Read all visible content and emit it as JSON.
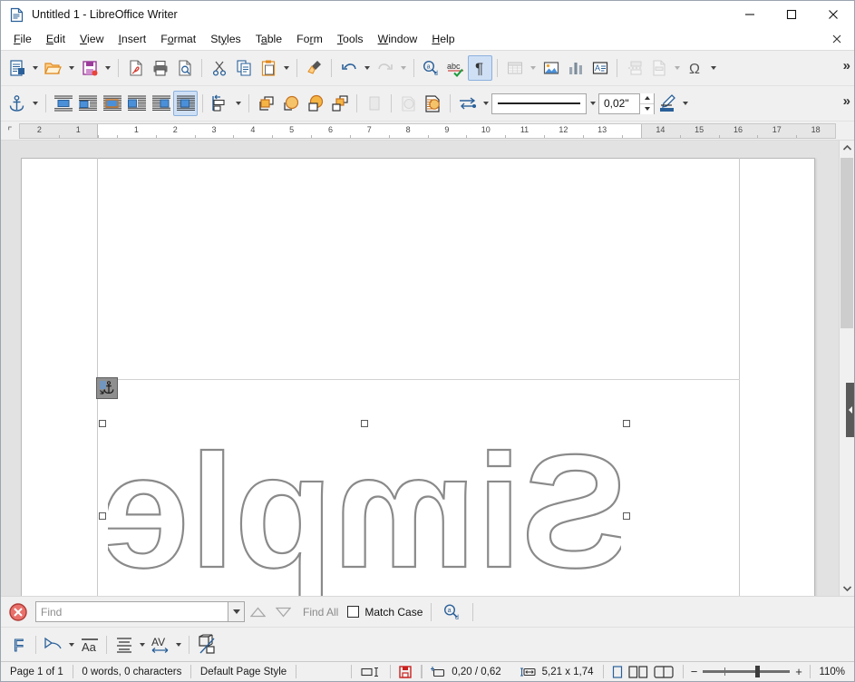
{
  "window": {
    "title": "Untitled 1 - LibreOffice Writer",
    "icon": "writer-document-icon",
    "minimize_label": "—",
    "maximize_label": "□",
    "close_label": "✕",
    "document_close_label": "✕"
  },
  "menubar": {
    "items": [
      {
        "label": "File",
        "accel": "F"
      },
      {
        "label": "Edit",
        "accel": "E"
      },
      {
        "label": "View",
        "accel": "V"
      },
      {
        "label": "Insert",
        "accel": "I"
      },
      {
        "label": "Format",
        "accel": "o"
      },
      {
        "label": "Styles",
        "accel": "y"
      },
      {
        "label": "Table",
        "accel": "a"
      },
      {
        "label": "Form",
        "accel": "r"
      },
      {
        "label": "Tools",
        "accel": "T"
      },
      {
        "label": "Window",
        "accel": "W"
      },
      {
        "label": "Help",
        "accel": "H"
      }
    ]
  },
  "standard_toolbar": {
    "items": [
      {
        "name": "new-document-button",
        "label": "New",
        "dropdown": true
      },
      {
        "name": "open-button",
        "label": "Open",
        "dropdown": true
      },
      {
        "name": "save-button",
        "label": "Save",
        "dropdown": true
      },
      {
        "name": "export-pdf-button",
        "label": "Export as PDF"
      },
      {
        "name": "print-button",
        "label": "Print"
      },
      {
        "name": "print-preview-button",
        "label": "Toggle Print Preview"
      },
      {
        "name": "cut-button",
        "label": "Cut"
      },
      {
        "name": "copy-button",
        "label": "Copy"
      },
      {
        "name": "paste-button",
        "label": "Paste",
        "dropdown": true
      },
      {
        "name": "clone-formatting-button",
        "label": "Clone Formatting"
      },
      {
        "name": "undo-button",
        "label": "Undo",
        "dropdown": true
      },
      {
        "name": "redo-button",
        "label": "Redo",
        "dropdown": true,
        "disabled": true
      },
      {
        "name": "find-and-replace-button",
        "label": "Find and Replace"
      },
      {
        "name": "spelling-button",
        "label": "Check Spelling"
      },
      {
        "name": "formatting-marks-button",
        "label": "Formatting Marks",
        "active": true
      },
      {
        "name": "insert-table-button",
        "label": "Insert Table",
        "dropdown": true,
        "disabled": true
      },
      {
        "name": "insert-image-button",
        "label": "Insert Image"
      },
      {
        "name": "insert-chart-button",
        "label": "Insert Chart"
      },
      {
        "name": "insert-text-box-button",
        "label": "Insert Text Box"
      },
      {
        "name": "insert-page-break-button",
        "label": "Insert Page Break",
        "disabled": true
      },
      {
        "name": "insert-field-button",
        "label": "Insert Field",
        "dropdown": true,
        "disabled": true
      },
      {
        "name": "insert-special-character-button",
        "label": "Insert Special Character",
        "dropdown": true
      }
    ],
    "overflow_label": "»"
  },
  "image_toolbar": {
    "items": [
      {
        "name": "anchor-button",
        "label": "Anchor",
        "dropdown": true
      },
      {
        "name": "wrap-off-button",
        "label": "Wrap Off"
      },
      {
        "name": "wrap-page-button",
        "label": "Wrap Page"
      },
      {
        "name": "wrap-through-button",
        "label": "Wrap Through"
      },
      {
        "name": "wrap-left-button",
        "label": "Wrap Left"
      },
      {
        "name": "wrap-right-button",
        "label": "Wrap Right"
      },
      {
        "name": "wrap-optimal-button",
        "label": "Optimal Page Wrap",
        "active": true
      },
      {
        "name": "align-objects-button",
        "label": "Align Objects",
        "dropdown": true
      },
      {
        "name": "bring-forward-button",
        "label": "Bring Forward"
      },
      {
        "name": "bring-to-front-button",
        "label": "Bring to Front"
      },
      {
        "name": "send-to-back-button",
        "label": "Send to Back"
      },
      {
        "name": "send-backward-button",
        "label": "Send Backward"
      },
      {
        "name": "rotate-button",
        "label": "Rotate",
        "disabled": true
      },
      {
        "name": "filter-button",
        "label": "Filter",
        "disabled": true
      },
      {
        "name": "area-style-button",
        "label": "Area Style / Filling"
      },
      {
        "name": "arrow-style-button",
        "label": "Arrow Style",
        "dropdown": true
      }
    ],
    "line_style_label": "Line Style",
    "line_width_value": "0,02\"",
    "line_color_label": "Line Color",
    "overflow_label": "»"
  },
  "ruler": {
    "corner_icon": "tab-stop-icon",
    "unit": "inch",
    "left_margin_ticks": [
      "2",
      "1"
    ],
    "content_ticks": [
      "1",
      "2",
      "3",
      "4",
      "5",
      "6",
      "7",
      "8",
      "9",
      "10",
      "11",
      "12",
      "13"
    ],
    "right_margin_ticks": [
      "14",
      "15",
      "16",
      "17",
      "18"
    ]
  },
  "document": {
    "fontwork": {
      "text": "Simple",
      "mirrored": true,
      "outline_color": "#8a8a8a",
      "fill": "none",
      "selected": true,
      "handle_count": 8
    },
    "anchor_icon": "anchor-to-paragraph-icon"
  },
  "find_toolbar": {
    "close_label": "Close Find Bar",
    "search_value": "",
    "search_placeholder": "Find",
    "find_previous_label": "Find Previous",
    "find_next_label": "Find Next",
    "find_all_label": "Find All",
    "match_case_label": "Match Case",
    "match_case_checked": false,
    "find_replace_label": "Find and Replace"
  },
  "fontwork_toolbar": {
    "items": [
      {
        "name": "fontwork-gallery-button",
        "label": "Fontwork Gallery"
      },
      {
        "name": "fontwork-shape-button",
        "label": "Fontwork Shape",
        "dropdown": true
      },
      {
        "name": "fontwork-same-letter-heights-button",
        "label": "Fontwork Same Letter Heights"
      },
      {
        "name": "fontwork-alignment-button",
        "label": "Fontwork Alignment",
        "dropdown": true
      },
      {
        "name": "fontwork-character-spacing-button",
        "label": "Fontwork Character Spacing",
        "dropdown": true
      },
      {
        "name": "extrusion-toggle-button",
        "label": "Toggle Extrusion"
      }
    ]
  },
  "statusbar": {
    "page": "Page 1 of 1",
    "words": "0 words, 0 characters",
    "page_style": "Default Page Style",
    "language": "",
    "selection_mode_icon": "selection-mode-icon",
    "save_state_icon": "unsaved-changes-icon",
    "position_icon": "object-position-icon",
    "position": "0,20 / 0,62",
    "size_icon": "object-size-icon",
    "size": "5,21 x 1,74",
    "view_single_page_icon": "single-page-view-icon",
    "view_multi_page_icon": "multi-page-view-icon",
    "view_book_icon": "book-view-icon",
    "zoom_out_label": "−",
    "zoom_in_label": "+",
    "zoom_level": "110%"
  },
  "colors": {
    "accent": "#2a6099",
    "highlight": "#cfe0f5",
    "toolbar_bg": "#f0f0f0",
    "workarea_bg": "#e2e2e2",
    "page_bg": "#ffffff",
    "fontwork_outline": "#8a8a8a",
    "unsaved_red": "#c9211e"
  }
}
